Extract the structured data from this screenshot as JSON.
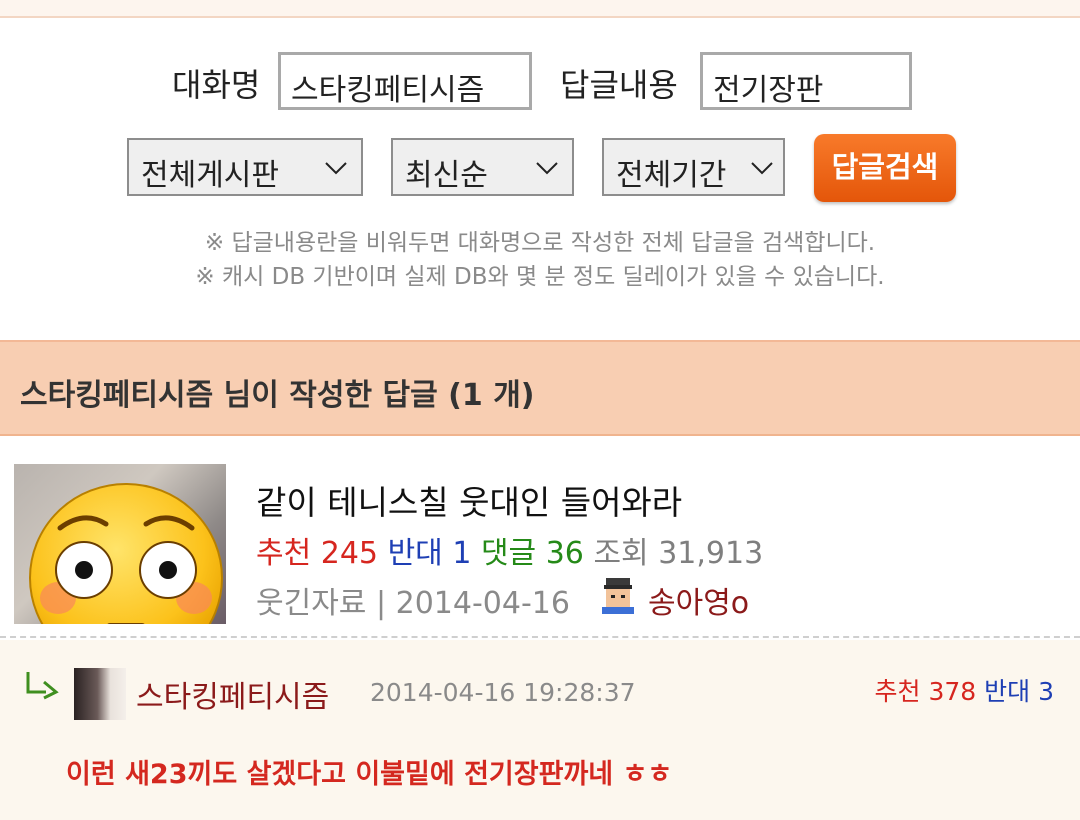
{
  "search": {
    "nickname_label": "대화명",
    "nickname_value": "스타킹페티시즘",
    "content_label": "답글내용",
    "content_value": "전기장판",
    "board_select": "전체게시판",
    "sort_select": "최신순",
    "period_select": "전체기간",
    "search_button": "답글검색",
    "note1": "※ 답글내용란을 비워두면 대화명으로 작성한 전체 답글을 검색합니다.",
    "note2": "※ 캐시 DB 기반이며 실제 DB와 몇 분 정도 딜레이가 있을 수 있습니다."
  },
  "results": {
    "header": "스타킹페티시즘 님이 작성한 답글 (1 개)"
  },
  "post": {
    "title": "같이 테니스칠 웃대인 들어와라",
    "recommend_label": "추천",
    "recommend_value": "245",
    "oppose_label": "반대",
    "oppose_value": "1",
    "comments_label": "댓글",
    "comments_value": "36",
    "views_label": "조회",
    "views_value": "31,913",
    "category": "웃긴자료",
    "separator": "|",
    "date": "2014-04-16",
    "author": "송아영o"
  },
  "reply": {
    "author": "스타킹페티시즘",
    "datetime": "2014-04-16 19:28:37",
    "recommend_label": "추천",
    "recommend_value": "378",
    "oppose_label": "반대",
    "oppose_value": "3",
    "text": "이런 새23끼도 살겠다고 이불밑에 전기장판까네 ㅎㅎ"
  },
  "colors": {
    "accent": "#ef6a1a",
    "header_bg": "#f8ceb2",
    "recommend": "#d6261f",
    "oppose": "#1e3fb4",
    "comments": "#258a18",
    "author": "#8b1a1a"
  },
  "icons": [
    "chevron-down-icon",
    "reply-arrow-icon",
    "flushed-emoji-icon",
    "user-level-icon"
  ]
}
